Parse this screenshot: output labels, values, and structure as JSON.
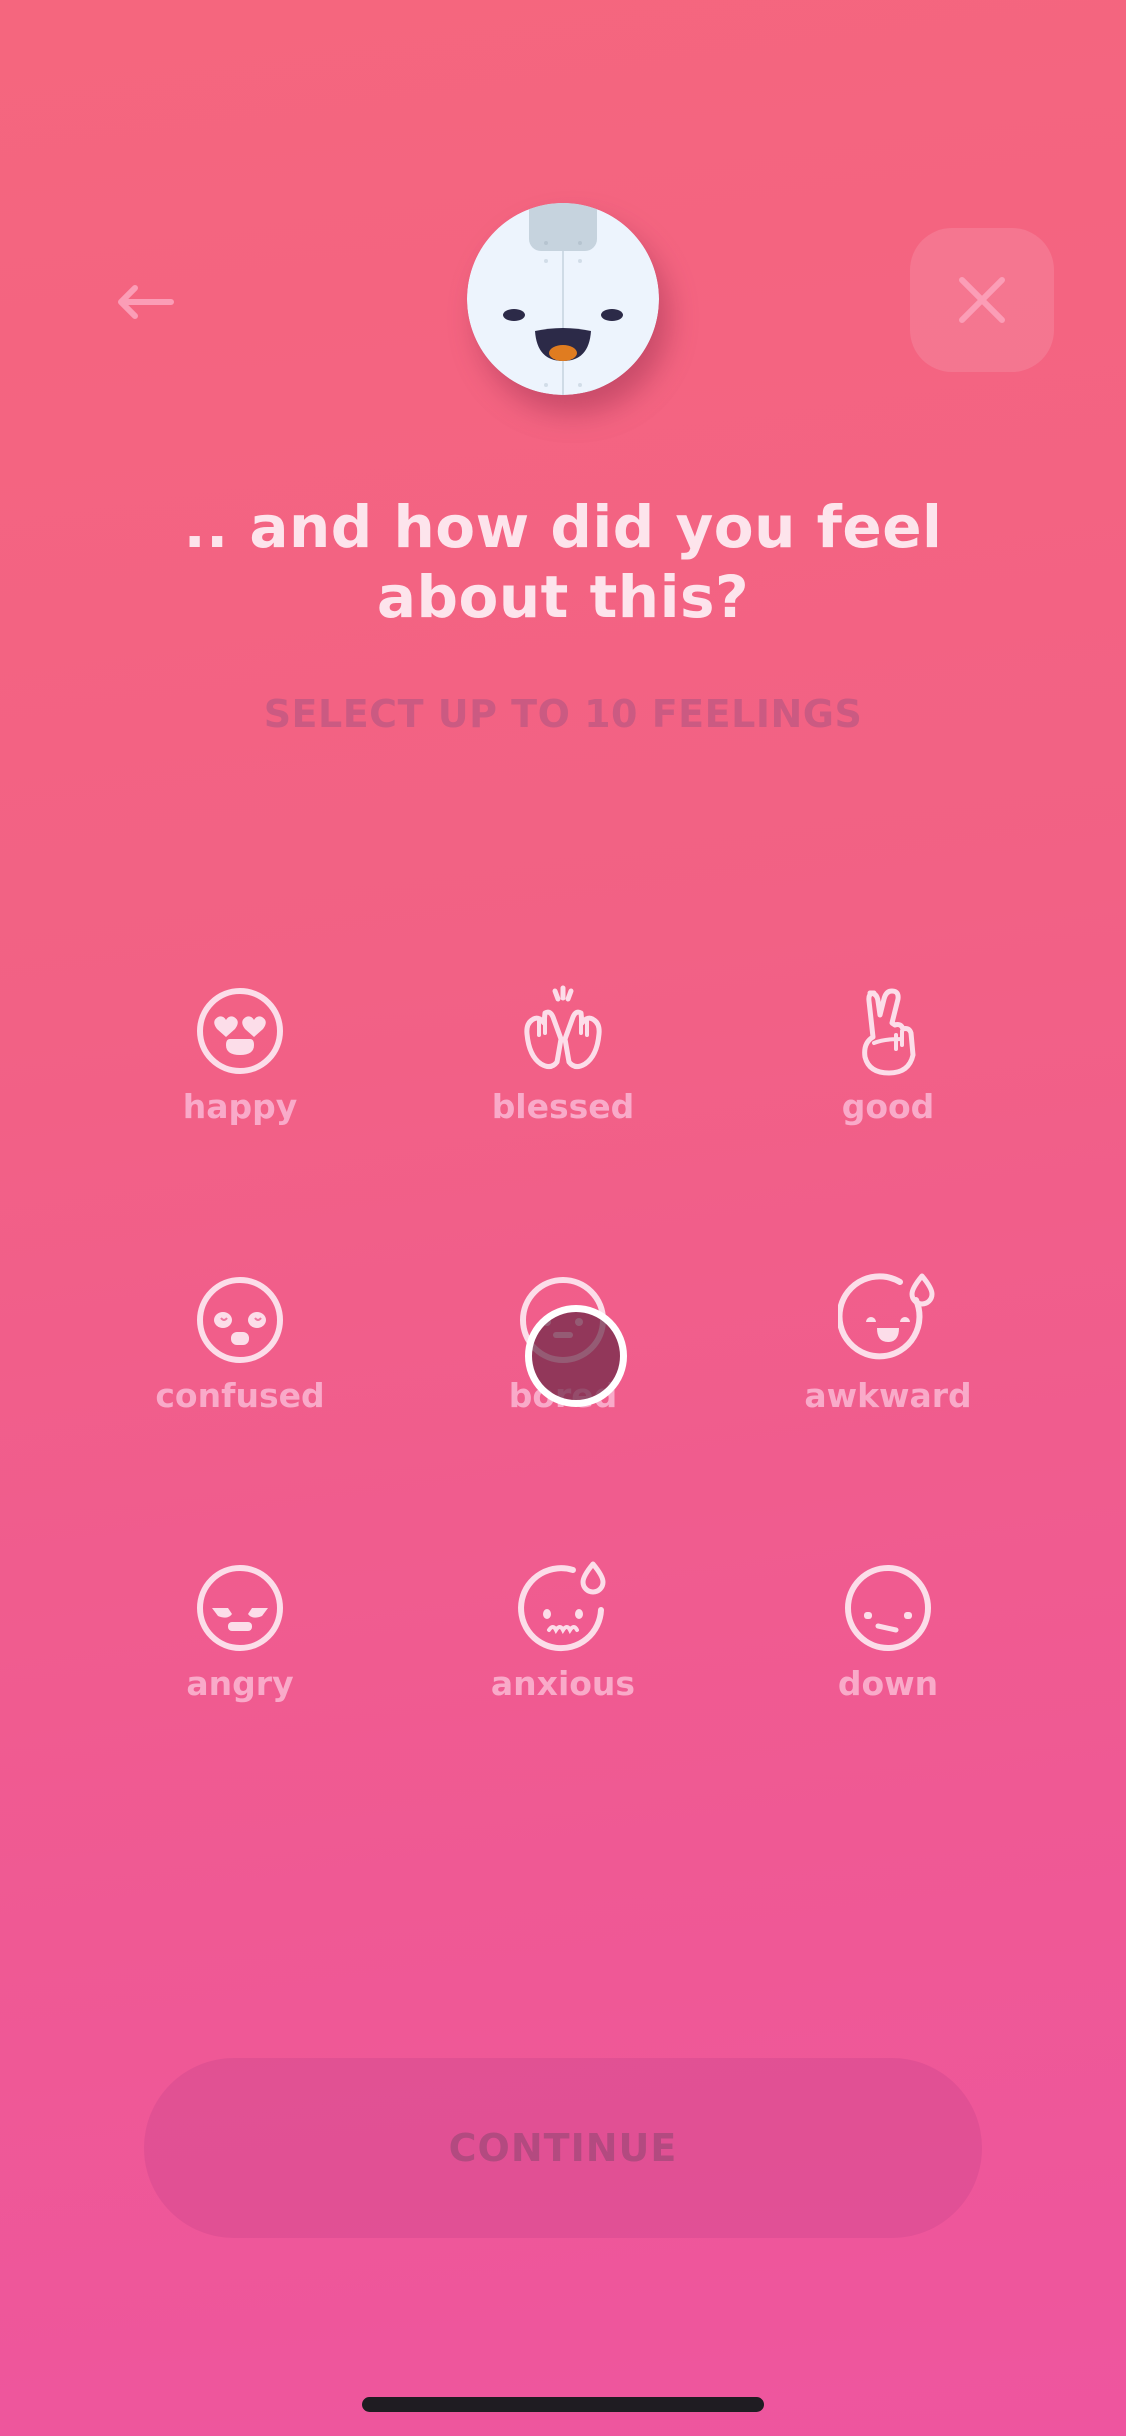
{
  "header": {
    "back_icon": "arrow-left-icon",
    "close_icon": "close-x-icon",
    "mascot": "smiling-round-mascot"
  },
  "question": {
    "title": ".. and how did you feel about this?",
    "subtitle": "SELECT UP TO 10 FEELINGS"
  },
  "feelings": [
    {
      "label": "happy",
      "icon": "heart-eyes-face-icon"
    },
    {
      "label": "blessed",
      "icon": "raised-hands-icon"
    },
    {
      "label": "good",
      "icon": "victory-hand-icon"
    },
    {
      "label": "confused",
      "icon": "confused-face-icon"
    },
    {
      "label": "bored",
      "icon": "bored-face-icon"
    },
    {
      "label": "awkward",
      "icon": "sweat-smile-face-icon"
    },
    {
      "label": "angry",
      "icon": "angry-face-icon"
    },
    {
      "label": "anxious",
      "icon": "anxious-sweat-face-icon"
    },
    {
      "label": "down",
      "icon": "sad-face-icon"
    }
  ],
  "footer": {
    "continue_label": "CONTINUE"
  },
  "colors": {
    "background_top": "#f5667e",
    "background_bottom": "#ee559f",
    "title_text": "#fde4ec",
    "subtitle_text": "#cb5a82",
    "label_text": "#f9aac9",
    "icon_stroke": "#fcdde9"
  }
}
